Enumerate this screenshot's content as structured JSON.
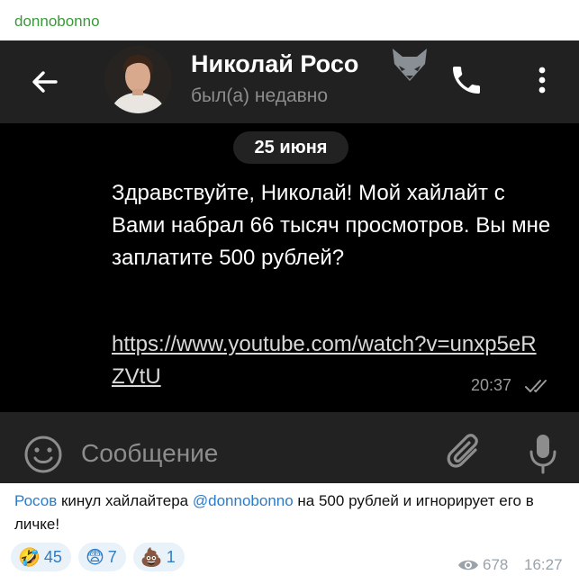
{
  "channel": {
    "name": "donnobonno"
  },
  "chat": {
    "contact_name": "Николай Росо",
    "status": "был(а) недавно",
    "date": "25 июня",
    "message_text": "Здравствуйте, Николай! Мой хайлайт с Вами набрал 66 тысяч просмотров. Вы мне заплатите 500 рублей?",
    "message_link": "https://www.youtube.com/watch?v=unxp5eRZVtU",
    "message_time": "20:37",
    "input_placeholder": "Сообщение"
  },
  "caption": {
    "part1": "Росов",
    "part2": " кинул хайлайтера ",
    "part3": "@donnobonno",
    "part4": " на 500 рублей и игнорирует его в личке!"
  },
  "reactions": [
    {
      "emoji": "🤣",
      "count": "45"
    },
    {
      "emoji": "😨",
      "count": "7"
    },
    {
      "emoji": "💩",
      "count": "1"
    }
  ],
  "post": {
    "views": "678",
    "time": "16:27"
  },
  "icons": [
    "back-arrow-icon",
    "fox-icon",
    "phone-icon",
    "more-vertical-icon",
    "double-check-icon",
    "emoji-icon",
    "paperclip-icon",
    "microphone-icon",
    "eye-icon"
  ],
  "colors": {
    "accent_green": "#3a9a3a",
    "link_blue": "#2a7bc9",
    "chat_bg": "#000000",
    "bar_bg": "#212121"
  }
}
